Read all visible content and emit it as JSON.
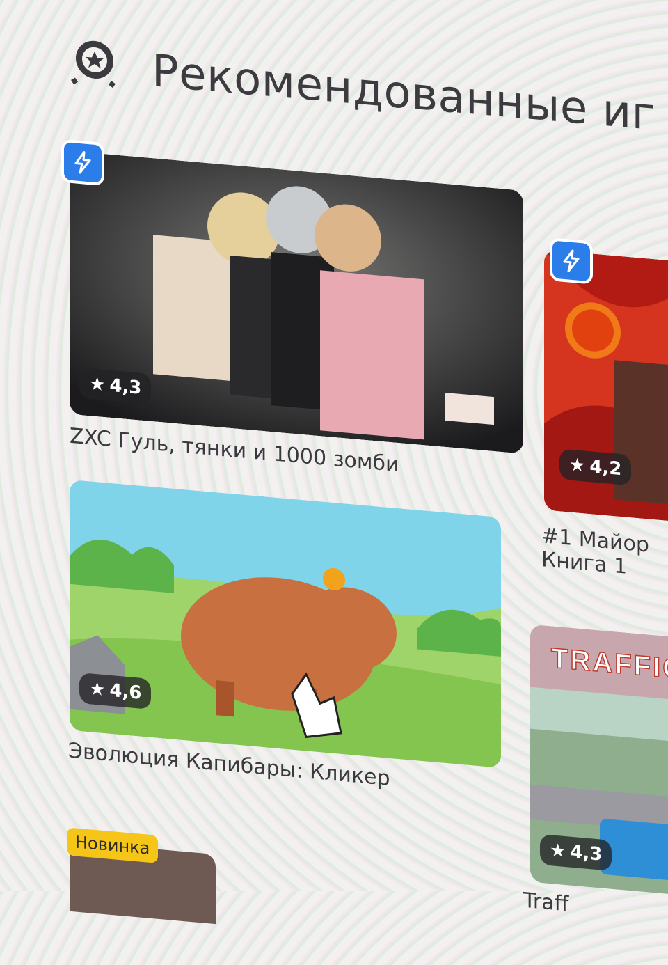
{
  "section": {
    "title": "Рекомендованные иг",
    "icon": "star-badge-icon"
  },
  "games": [
    {
      "title": "ZXC Гуль, тянки и 1000 зомби",
      "rating": "4,3",
      "badge_icon": "lightning-icon"
    },
    {
      "title_line1": "#1 Майор",
      "title_line2": "Книга 1",
      "rating": "4,2",
      "badge_icon": "lightning-icon"
    },
    {
      "title": "Эволюция Капибары: Кликер",
      "rating": "4,6"
    },
    {
      "banner_text": "TRAFFIC",
      "title": "Traff",
      "rating": "4,3"
    },
    {
      "tag": "Новинка"
    }
  ],
  "colors": {
    "accent": "#2b7dea",
    "new_badge": "#f5c518",
    "rating_bg": "#232326"
  }
}
